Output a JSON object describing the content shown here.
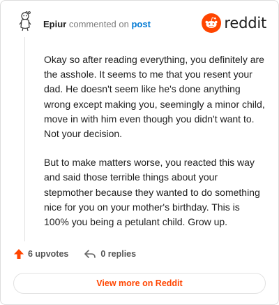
{
  "comment": {
    "author": "Epiur",
    "action_text": "commented on",
    "target_link": "post",
    "paragraphs": [
      "Okay so after reading everything, you definitely are the asshole. It seems to me that you resent your dad. He doesn't seem like he's done anything wrong except making you, seemingly a minor child, move in with him even though you didn't want to. Not your decision.",
      "But to make matters worse, you reacted this way and said those terrible things about your stepmother because they wanted to do something nice for you on your mother's birthday. This is 100% you being a petulant child. Grow up."
    ]
  },
  "brand": {
    "wordmark": "reddit",
    "color": "#ff4500"
  },
  "actions": {
    "upvotes_label": "6 upvotes",
    "replies_label": "0 replies",
    "upvote_icon": "upvote-arrow-icon",
    "reply_icon": "reply-arrow-icon",
    "upvote_color": "#ff4500"
  },
  "footer": {
    "view_more_label": "View more on Reddit"
  }
}
